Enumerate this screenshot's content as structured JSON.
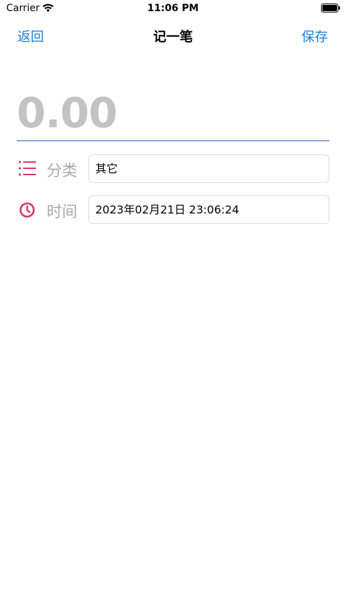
{
  "status_bar": {
    "carrier": "Carrier",
    "time": "11:06 PM",
    "wifi_icon": "wifi-icon",
    "battery_icon": "battery-icon"
  },
  "nav": {
    "back_label": "返回",
    "title": "记一笔",
    "save_label": "保存"
  },
  "amount": {
    "value": "0.00"
  },
  "category": {
    "icon": "list-icon",
    "label": "分类",
    "value": "其它"
  },
  "time_row": {
    "icon": "clock-icon",
    "label": "时间",
    "value": "2023年02月21日 23:06:24"
  },
  "colors": {
    "accent": "#1a7fe0",
    "icon_pink": "#d6336c",
    "amount_gray": "#c3c3c3",
    "underline": "#2a5ea8"
  }
}
